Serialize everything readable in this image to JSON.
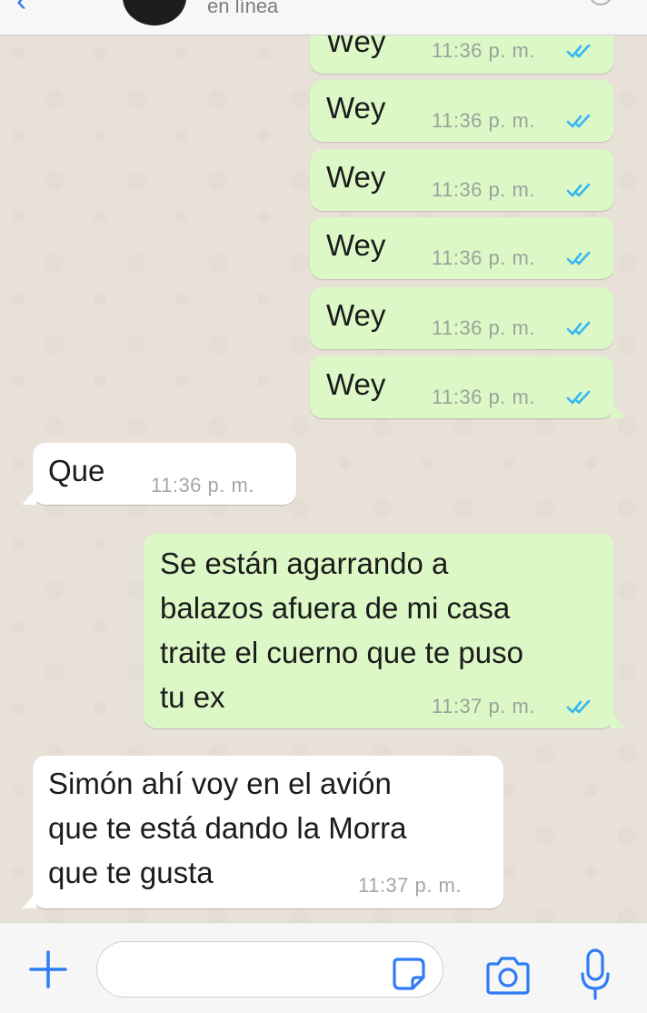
{
  "header": {
    "status": "en línea"
  },
  "messages": [
    {
      "type": "out",
      "text": "Wey",
      "time": "11:36 p. m."
    },
    {
      "type": "out",
      "text": "Wey",
      "time": "11:36 p. m."
    },
    {
      "type": "out",
      "text": "Wey",
      "time": "11:36 p. m."
    },
    {
      "type": "out",
      "text": "Wey",
      "time": "11:36 p. m."
    },
    {
      "type": "out",
      "text": "Wey",
      "time": "11:36 p. m."
    },
    {
      "type": "out",
      "text": "Wey",
      "time": "11:36 p. m."
    },
    {
      "type": "in",
      "text": "Que",
      "time": "11:36 p. m."
    },
    {
      "type": "out",
      "lines": [
        "Se están agarrando a",
        "balazos afuera de mi casa",
        "traite el cuerno que te puso",
        "tu ex"
      ],
      "time": "11:37 p. m."
    },
    {
      "type": "in",
      "lines": [
        "Simón ahí voy en el avión",
        "que te está dando la Morra",
        "que te gusta"
      ],
      "time": "11:37 p. m."
    }
  ],
  "composer": {
    "input_value": ""
  },
  "icons": {
    "back": "chevron-left-icon",
    "add": "plus-icon",
    "sticker": "sticker-icon",
    "camera": "camera-icon",
    "mic": "microphone-icon",
    "read_receipt": "double-check-icon"
  },
  "colors": {
    "accent": "#2f7cf6",
    "outgoing_bubble": "#dcf8c6",
    "incoming_bubble": "#ffffff",
    "chat_background": "#e8e1d8",
    "read_ticks": "#34b7f1"
  }
}
